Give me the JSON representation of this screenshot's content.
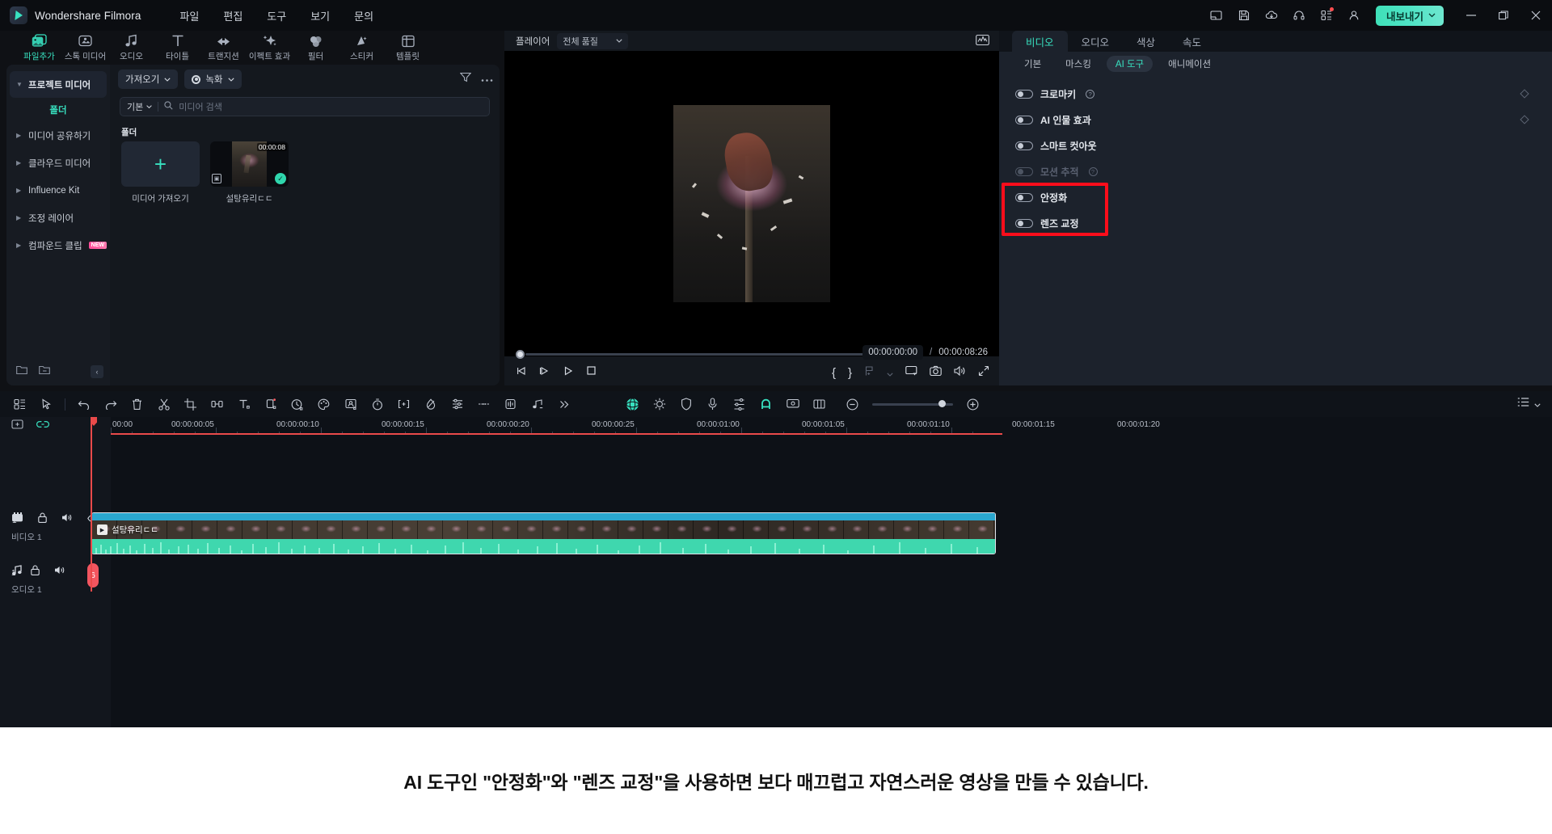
{
  "titlebar": {
    "brand": "Wondershare Filmora",
    "menu": [
      "파일",
      "편집",
      "도구",
      "보기",
      "문의"
    ],
    "right_icons": [
      "panel-layout-icon",
      "save-icon",
      "cloud-upload-icon",
      "headset-support-icon",
      "apps-grid-icon",
      "account-icon"
    ],
    "export_label": "내보내기",
    "window_controls": [
      "minimize",
      "maximize",
      "close"
    ]
  },
  "tooltabs": [
    {
      "label": "파일추가",
      "icon": "media-image-icon",
      "active": true
    },
    {
      "label": "스톡 미디어",
      "icon": "stock-media-icon",
      "active": false
    },
    {
      "label": "오디오",
      "icon": "music-note-icon",
      "active": false
    },
    {
      "label": "타이틀",
      "icon": "text-title-icon",
      "active": false
    },
    {
      "label": "트랜지션",
      "icon": "transition-arrows-icon",
      "active": false
    },
    {
      "label": "이펙트 효과",
      "icon": "sparkle-effect-icon",
      "active": false
    },
    {
      "label": "필터",
      "icon": "filter-circles-icon",
      "active": false
    },
    {
      "label": "스티커",
      "icon": "sticker-icon",
      "active": false
    },
    {
      "label": "템플릿",
      "icon": "template-grid-icon",
      "active": false
    }
  ],
  "sidebar": {
    "items": [
      {
        "label": "프로젝트 미디어",
        "selected": true,
        "expanded": true
      },
      {
        "label": "폴더",
        "sub": true
      },
      {
        "label": "미디어 공유하기",
        "selected": false,
        "expanded": false
      },
      {
        "label": "클라우드 미디어",
        "selected": false,
        "expanded": false
      },
      {
        "label": "Influence Kit",
        "selected": false,
        "expanded": false
      },
      {
        "label": "조정 레이어",
        "selected": false,
        "expanded": false
      },
      {
        "label": "컴파운드 클립",
        "selected": false,
        "expanded": false,
        "badge": "NEW"
      }
    ]
  },
  "media_panel": {
    "import_button": "가져오기",
    "record_button": "녹화",
    "filter_icon": "filter-icon",
    "more_icon": "more-horizontal-icon",
    "sort_label": "기본",
    "search_placeholder": "미디어 검색",
    "section_title": "폴더",
    "items": [
      {
        "type": "import",
        "label": "미디어 가져오기",
        "icon": "plus-icon"
      },
      {
        "type": "clip",
        "label": "설탕유리ㄷㄷ",
        "duration": "00:00:08",
        "selected": true
      }
    ]
  },
  "player": {
    "label": "플레이어",
    "quality": "전체 품질",
    "histogram_icon": "waveform-scope-icon",
    "current_time": "00:00:00:00",
    "separator": "/",
    "total_time": "00:00:08:26",
    "controls_left": [
      "prev-frame-icon",
      "next-frame-icon",
      "play-icon",
      "stop-icon"
    ],
    "controls_right": [
      "mark-in-icon",
      "mark-out-icon",
      "marker-add-icon",
      "chevron-down-icon",
      "render-preview-icon",
      "snapshot-icon",
      "volume-icon",
      "fullscreen-icon"
    ]
  },
  "right_panel": {
    "tabs": [
      {
        "label": "비디오",
        "active": true
      },
      {
        "label": "오디오",
        "active": false
      },
      {
        "label": "색상",
        "active": false
      },
      {
        "label": "속도",
        "active": false
      }
    ],
    "subtabs": [
      {
        "label": "기본",
        "active": false
      },
      {
        "label": "마스킹",
        "active": false
      },
      {
        "label": "AI 도구",
        "active": true
      },
      {
        "label": "애니메이션",
        "active": false
      }
    ],
    "toggles": [
      {
        "label": "크로마키",
        "on": false,
        "disabled": false,
        "help": true,
        "keyframe": true
      },
      {
        "label": "AI 인물 효과",
        "on": false,
        "disabled": false,
        "help": false,
        "keyframe": true
      },
      {
        "label": "스마트 컷아웃",
        "on": false,
        "disabled": false,
        "help": false,
        "keyframe": false
      },
      {
        "label": "모션 추적",
        "on": false,
        "disabled": true,
        "help": true,
        "keyframe": false
      },
      {
        "label": "안정화",
        "on": false,
        "disabled": false,
        "help": false,
        "keyframe": false,
        "highlighted": true
      },
      {
        "label": "렌즈 교정",
        "on": false,
        "disabled": false,
        "help": false,
        "keyframe": false,
        "highlighted": true
      }
    ],
    "highlight_color": "#fb0d1b"
  },
  "timeline_toolbar": {
    "left_icons": [
      "grid-view-icon",
      "selection-tool-icon"
    ],
    "mid_icons": [
      "undo-icon",
      "redo-icon",
      "delete-icon",
      "split-scissors-icon",
      "crop-icon",
      "audio-detach-icon",
      "text-tool-icon",
      "keyframe-box-icon",
      "speed-clock-icon",
      "color-palette-icon",
      "green-screen-icon",
      "stopwatch-icon",
      "marker-bracket-icon",
      "mask-drop-icon",
      "adjust-sliders-icon",
      "silence-detect-icon",
      "audio-wave-icon",
      "beat-sync-icon",
      "more-chevrons-icon"
    ],
    "right_icons": [
      "ai-sphere-icon",
      "auto-enhance-icon",
      "shield-icon",
      "mic-icon",
      "audio-mixer-icon",
      "magnet-snap-icon",
      "record-screen-icon",
      "crop-ratio-icon"
    ],
    "zoom_out_icon": "zoom-out-icon",
    "zoom_in_icon": "zoom-in-icon",
    "list-view-icon": "list-view-icon"
  },
  "timeline": {
    "header_icons": [
      "add-track-icon",
      "link-icon"
    ],
    "ruler_ticks": [
      "00:00",
      "00:00:00:05",
      "00:00:00:10",
      "00:00:00:15",
      "00:00:00:20",
      "00:00:00:25",
      "00:00:01:00",
      "00:00:01:05",
      "00:00:01:10",
      "00:00:01:15",
      "00:00:01:20"
    ],
    "tracks": [
      {
        "name": "비디오 1",
        "number": "1",
        "icons": [
          "video-track-icon",
          "lock-icon",
          "mute-icon",
          "eye-icon"
        ]
      },
      {
        "name": "오디오 1",
        "number": "1",
        "icons": [
          "audio-track-icon",
          "lock-icon",
          "mute-icon"
        ]
      }
    ],
    "clip": {
      "name": "설탕유리ㄷㄷ",
      "play_icon": "play-icon"
    },
    "audio_marker": "6"
  },
  "caption": {
    "text": "AI 도구인 \"안정화\"와 \"렌즈 교정\"을 사용하면 보다 매끄럽고 자연스러운 영상을 만들 수 있습니다."
  }
}
